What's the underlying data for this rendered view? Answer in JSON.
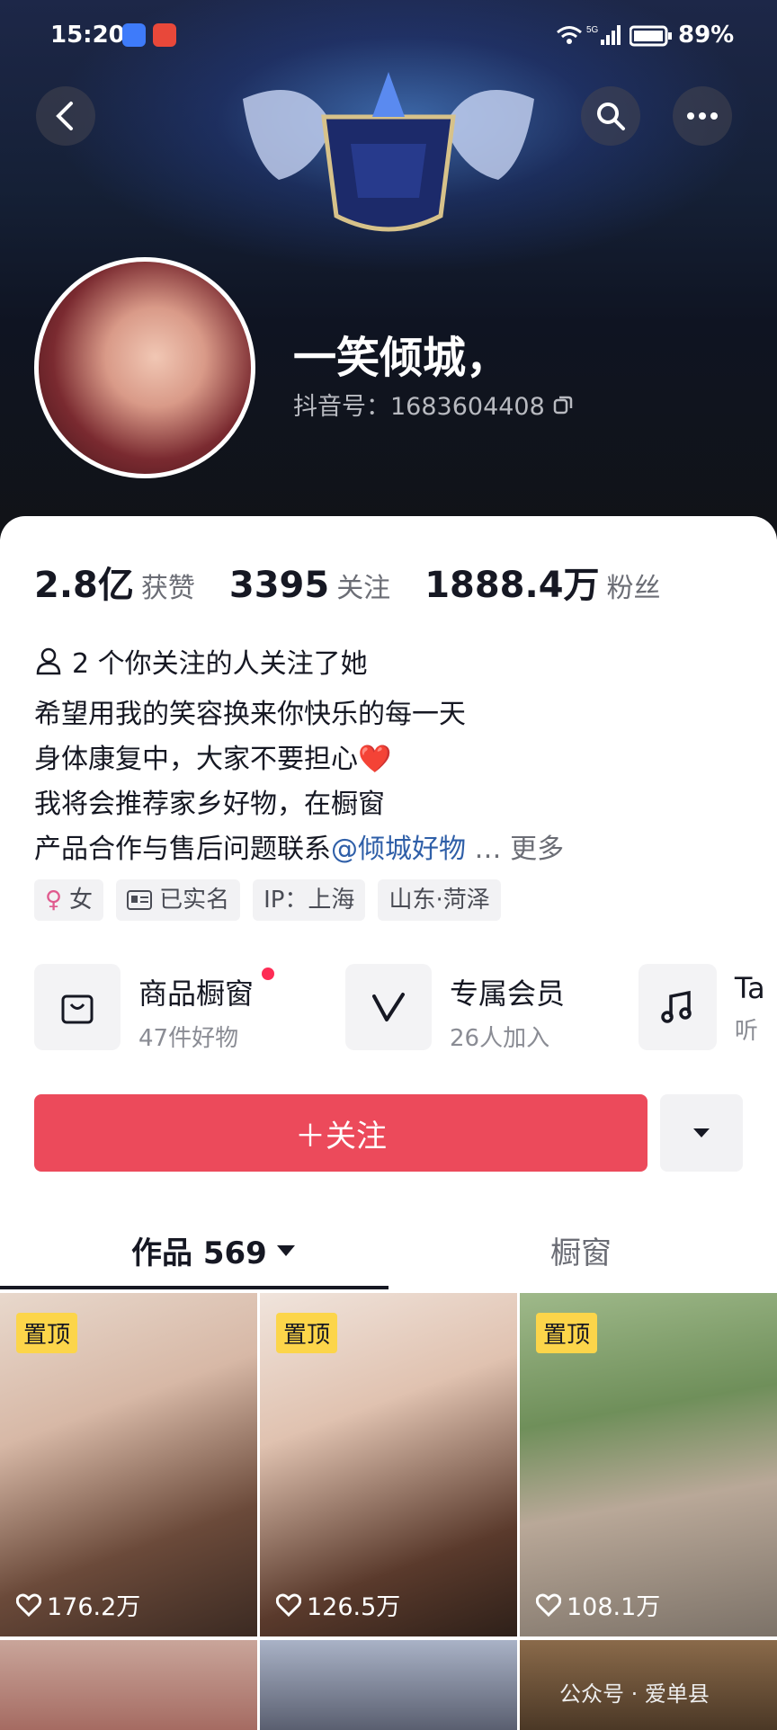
{
  "status_bar": {
    "time": "15:20",
    "battery": "89%"
  },
  "profile": {
    "nickname": "一笑倾城，",
    "douyin_id": "抖音号：1683604408"
  },
  "stats": [
    {
      "value": "2.8亿",
      "label": "获赞"
    },
    {
      "value": "3395",
      "label": "关注"
    },
    {
      "value": "1888.4万",
      "label": "粉丝"
    }
  ],
  "mutual_follow": "2 个你关注的人关注了她",
  "bio": {
    "line1": "希望用我的笑容换来你快乐的每一天",
    "line2": "身体康复中，大家不要担心❤️",
    "line3": "我将会推荐家乡好物，在橱窗",
    "line4_prefix": "产品合作与售后问题联系",
    "line4_mention": "@倾城好物",
    "line4_ellipsis": " … ",
    "more": "更多"
  },
  "tags": {
    "gender": "女",
    "verified": "已实名",
    "ip": "IP：上海",
    "location": "山东·菏泽"
  },
  "services": [
    {
      "title": "商品橱窗",
      "sub": "47件好物",
      "icon": "bag-icon"
    },
    {
      "title": "专属会员",
      "sub": "26人加入",
      "icon": "v-icon"
    },
    {
      "title": "Ta",
      "sub": "听叫",
      "icon": "music-icon"
    }
  ],
  "follow_button": "＋关注",
  "tabs": {
    "works": "作品 569",
    "window": "橱窗"
  },
  "videos": [
    {
      "pinned": "置顶",
      "likes": "176.2万"
    },
    {
      "pinned": "置顶",
      "likes": "126.5万"
    },
    {
      "pinned": "置顶",
      "likes": "108.1万"
    }
  ],
  "watermark": "公众号 · 爱单县",
  "colors": {
    "follow": "#ec4a5b",
    "mention": "#2f5fa8",
    "pin": "#fcd54a"
  }
}
